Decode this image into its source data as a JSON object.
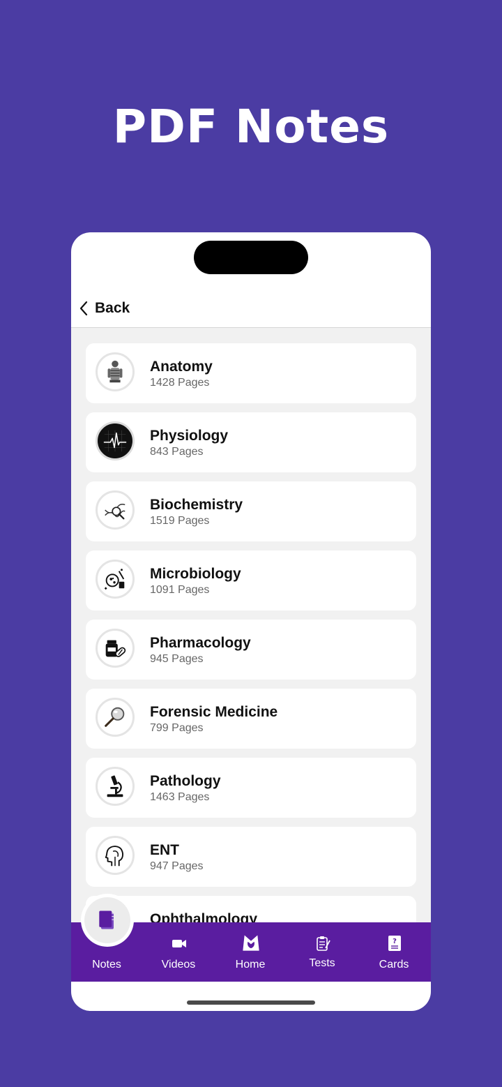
{
  "headline": "PDF Notes",
  "nav": {
    "back_label": "Back"
  },
  "subjects": [
    {
      "title": "Anatomy",
      "pages": "1428 Pages",
      "icon": "skeleton-torso-icon"
    },
    {
      "title": "Physiology",
      "pages": "843 Pages",
      "icon": "heartbeat-monitor-icon"
    },
    {
      "title": "Biochemistry",
      "pages": "1519 Pages",
      "icon": "dna-magnifier-icon"
    },
    {
      "title": "Microbiology",
      "pages": "1091 Pages",
      "icon": "petri-dish-icon"
    },
    {
      "title": "Pharmacology",
      "pages": "945 Pages",
      "icon": "pill-bottle-icon"
    },
    {
      "title": "Forensic Medicine",
      "pages": "799 Pages",
      "icon": "magnifying-glass-icon"
    },
    {
      "title": "Pathology",
      "pages": "1463 Pages",
      "icon": "microscope-icon"
    },
    {
      "title": "ENT",
      "pages": "947 Pages",
      "icon": "head-profile-icon"
    },
    {
      "title": "Ophthalmology",
      "pages": "",
      "icon": ""
    }
  ],
  "tabs": {
    "notes": "Notes",
    "videos": "Videos",
    "home": "Home",
    "tests": "Tests",
    "cards": "Cards"
  },
  "colors": {
    "background": "#4b3ca3",
    "tabbar": "#5a1da0",
    "notes_icon": "#5a1da0"
  }
}
